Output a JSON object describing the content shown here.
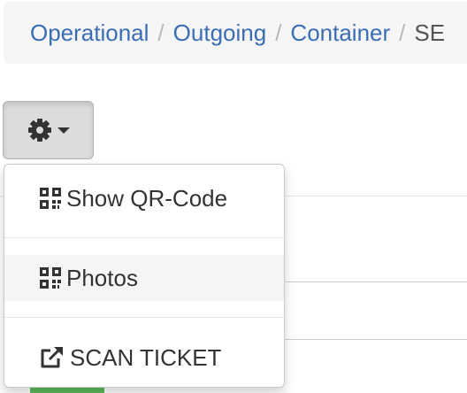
{
  "breadcrumb": {
    "items": [
      "Operational",
      "Outgoing",
      "Container"
    ],
    "current": "SE",
    "separator": "/"
  },
  "toolbar": {
    "actions_button_icon": "gear-icon",
    "caret_icon": "caret-down-icon"
  },
  "menu": {
    "items": [
      {
        "label": "Show QR-Code",
        "icon": "qrcode-icon"
      },
      {
        "label": "Photos",
        "icon": "qrcode-icon"
      },
      {
        "label": "SCAN TICKET",
        "icon": "external-link-icon"
      }
    ]
  },
  "colors": {
    "link": "#3b6db3",
    "breadcrumb_bg": "#f5f5f5",
    "button_bg": "#dcdcdc",
    "hover_bg": "#f5f5f5",
    "success": "#5cb85c"
  }
}
